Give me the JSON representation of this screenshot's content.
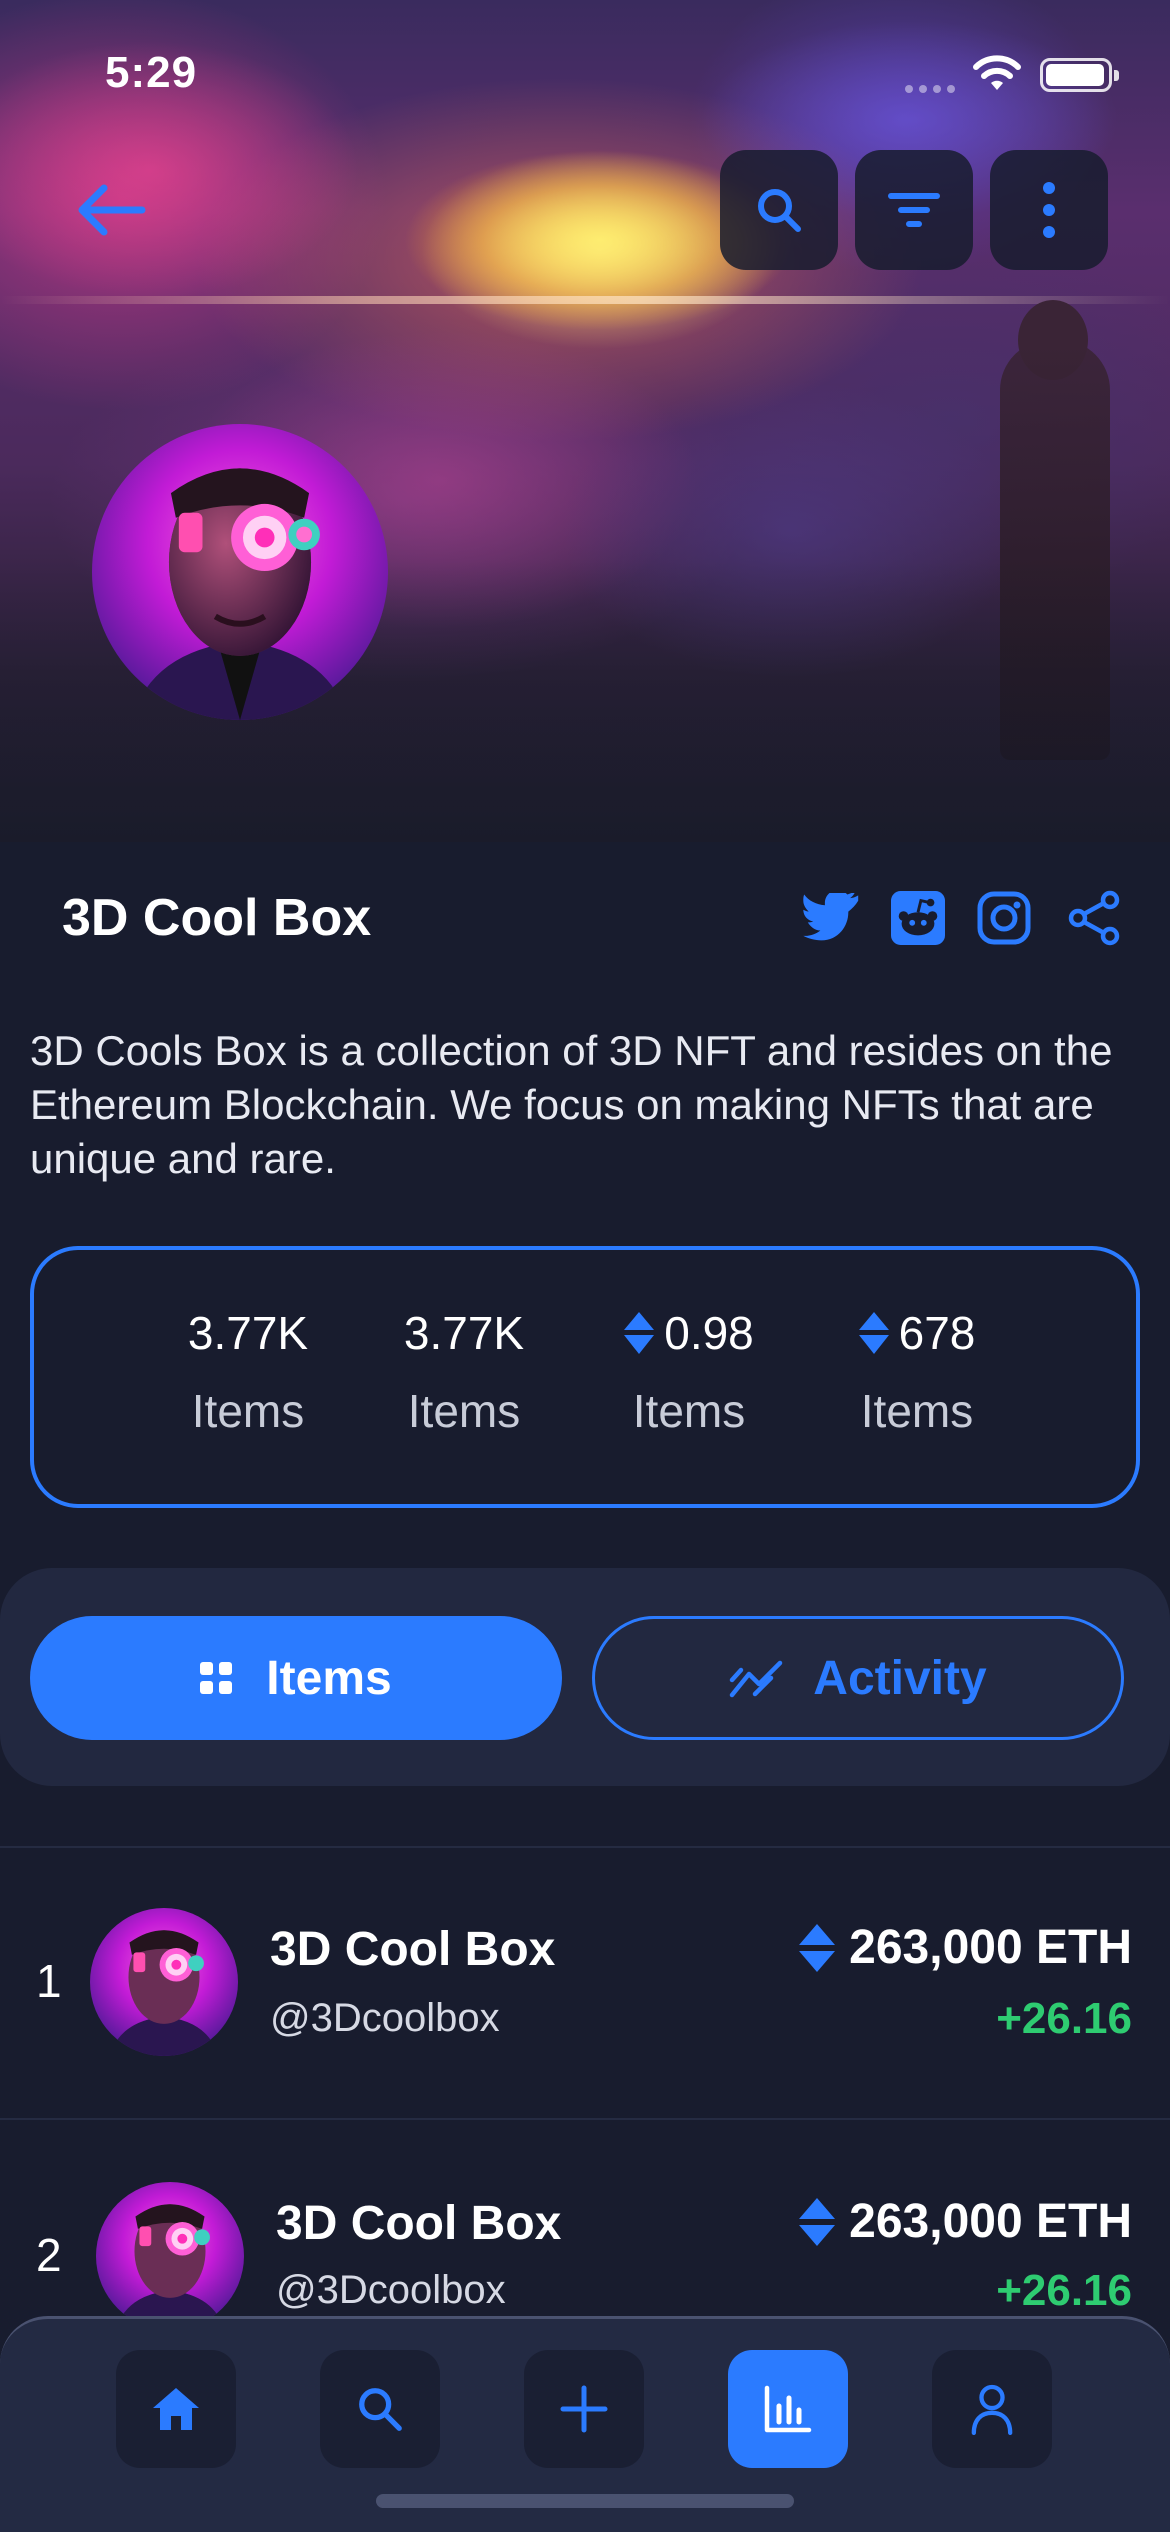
{
  "status_bar": {
    "time": "5:29"
  },
  "header": {
    "back_icon": "arrow-left-icon",
    "actions": [
      {
        "icon": "search-icon"
      },
      {
        "icon": "filter-icon"
      },
      {
        "icon": "more-vertical-icon"
      }
    ]
  },
  "collection": {
    "title": "3D Cool Box",
    "description": "3D Cools Box is a collection of 3D NFT and resides on the Ethereum Blockchain. We focus on making NFTs that are unique and rare.",
    "socials": [
      "twitter-icon",
      "reddit-icon",
      "instagram-icon",
      "share-icon"
    ]
  },
  "stats": [
    {
      "value": "3.77K",
      "label": "Items",
      "eth_icon": false
    },
    {
      "value": "3.77K",
      "label": "Items",
      "eth_icon": false
    },
    {
      "value": "0.98",
      "label": "Items",
      "eth_icon": true
    },
    {
      "value": "678",
      "label": "Items",
      "eth_icon": true
    }
  ],
  "tabs": {
    "items_label": "Items",
    "activity_label": "Activity",
    "selected": "Items"
  },
  "list": [
    {
      "rank": "1",
      "name": "3D Cool Box",
      "handle": "@3Dcoolbox",
      "price": "263,000 ETH",
      "change": "+26.16"
    },
    {
      "rank": "2",
      "name": "3D Cool Box",
      "handle": "@3Dcoolbox",
      "price": "263,000 ETH",
      "change": "+26.16"
    }
  ],
  "bottom_nav": [
    {
      "icon": "home-icon",
      "active": false
    },
    {
      "icon": "search-icon",
      "active": false
    },
    {
      "icon": "plus-icon",
      "active": false
    },
    {
      "icon": "bar-chart-icon",
      "active": true
    },
    {
      "icon": "user-icon",
      "active": false
    }
  ],
  "colors": {
    "background": "#181c2e",
    "accent": "#2b7bff",
    "positive": "#2ecc71",
    "panel": "#222840"
  }
}
